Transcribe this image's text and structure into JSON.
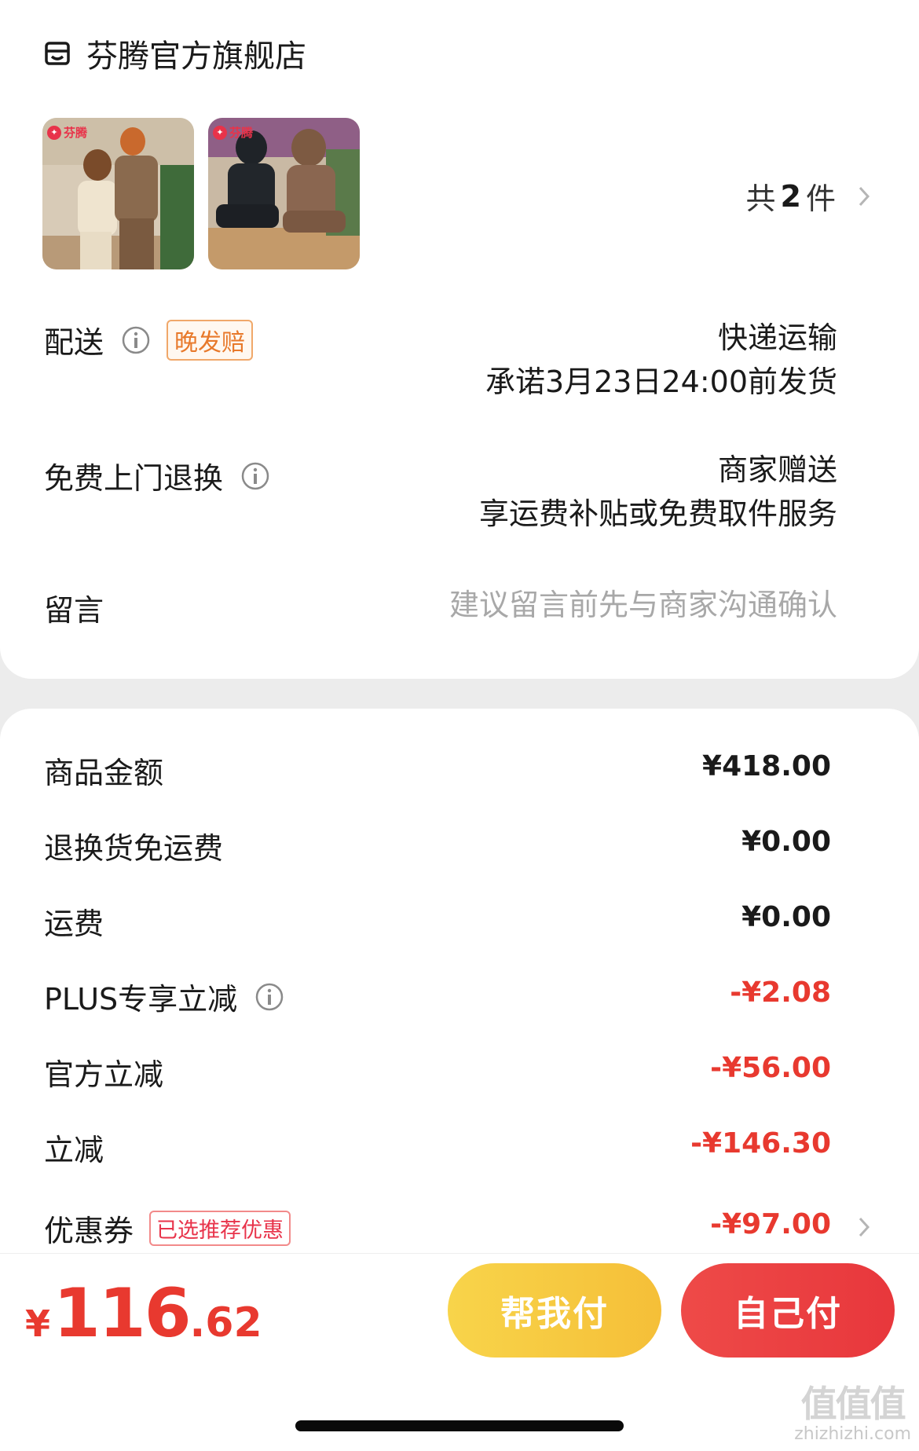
{
  "store": {
    "name": "芬腾官方旗舰店",
    "icon": "store-icon"
  },
  "products": {
    "thumbs": [
      {
        "brand": "芬腾",
        "alt": "product-image-1"
      },
      {
        "brand": "芬腾",
        "alt": "product-image-2"
      }
    ],
    "count_prefix": "共",
    "count_num": "2",
    "count_suffix": "件"
  },
  "delivery": {
    "label": "配送",
    "tag": "晚发赔",
    "method": "快递运输",
    "promise": "承诺3月23日24:00前发货"
  },
  "returns": {
    "label": "免费上门退换",
    "line1": "商家赠送",
    "line2": "享运费补贴或免费取件服务"
  },
  "note": {
    "label": "留言",
    "placeholder": "建议留言前先与商家沟通确认"
  },
  "fees": [
    {
      "label": "商品金额",
      "value": "¥418.00"
    },
    {
      "label": "退换货免运费",
      "value": "¥0.00"
    },
    {
      "label": "运费",
      "value": "¥0.00"
    },
    {
      "label": "PLUS专享立减",
      "value": "-¥2.08"
    },
    {
      "label": "官方立减",
      "value": "-¥56.00"
    },
    {
      "label": "立减",
      "value": "-¥146.30"
    },
    {
      "label": "优惠券",
      "value": "-¥97.00",
      "tag": "已选推荐优惠"
    }
  ],
  "total": {
    "currency": "¥",
    "integer": "116",
    "decimal": ".62"
  },
  "buttons": {
    "help_pay": "帮我付",
    "self_pay": "自己付"
  },
  "watermark": {
    "big": "值值值",
    "small": "zhizhizhi.com"
  },
  "colors": {
    "accent_red": "#e8392f",
    "help_yellow": "#f6c93f",
    "self_red": "#ea4143"
  }
}
